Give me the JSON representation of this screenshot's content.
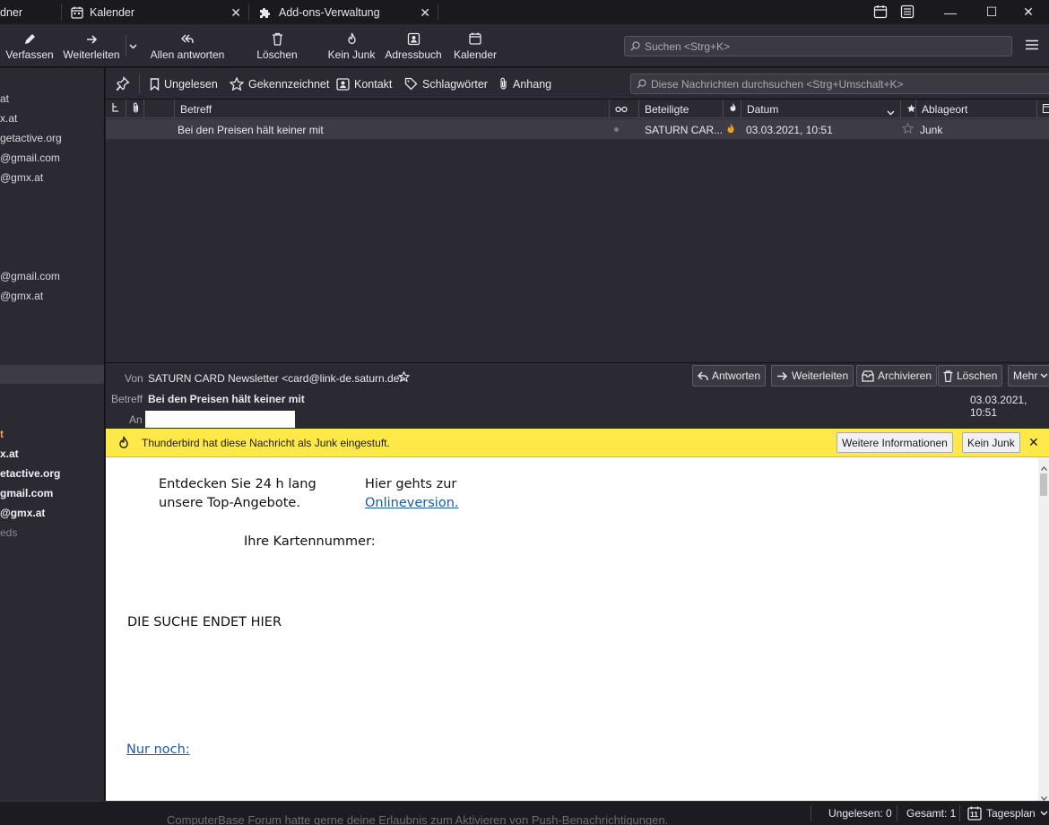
{
  "tabs": [
    {
      "label": "dner"
    },
    {
      "label": "Kalender",
      "close": "✕"
    },
    {
      "label": "Add-ons-Verwaltung",
      "close": "✕"
    }
  ],
  "window_controls": {
    "minimize": "—",
    "maximize": "☐",
    "close": "✕"
  },
  "toolbar": {
    "compose": "Verfassen",
    "forward": "Weiterleiten",
    "reply_all": "Allen antworten",
    "delete": "Löschen",
    "not_junk": "Kein Junk",
    "address_book": "Adressbuch",
    "calendar": "Kalender",
    "search_placeholder": "Suchen <Strg+K>"
  },
  "folder_pane": {
    "items_top": [
      "at",
      "x.at",
      "getactive.org",
      "@gmail.com",
      "@gmx.at"
    ],
    "items_mid": [
      "@gmail.com",
      "@gmx.at"
    ],
    "items_bottom": [
      "t",
      "x.at",
      "etactive.org",
      "gmail.com",
      "@gmx.at",
      "eds"
    ]
  },
  "quick_filter": {
    "unread": "Ungelesen",
    "starred": "Gekennzeichnet",
    "contact": "Kontakt",
    "tags": "Schlagwörter",
    "attachment": "Anhang",
    "search_placeholder": "Diese Nachrichten durchsuchen <Strg+Umschalt+K>"
  },
  "thread_columns": {
    "subject": "Betreff",
    "correspondents": "Beteiligte",
    "date": "Datum",
    "location": "Ablageort"
  },
  "messages": [
    {
      "subject": "Bei den Preisen hält keiner mit",
      "correspondent": "SATURN CAR...",
      "date": "03.03.2021, 10:51",
      "location": "Junk"
    }
  ],
  "header": {
    "from_label": "Von",
    "from": "SATURN CARD Newsletter <card@link-de.saturn.de>",
    "subject_label": "Betreff",
    "subject": "Bei den Preisen hält keiner mit",
    "to_label": "An",
    "date": "03.03.2021, 10:51",
    "buttons": {
      "reply": "Antworten",
      "forward": "Weiterleiten",
      "archive": "Archivieren",
      "delete": "Löschen",
      "more": "Mehr"
    }
  },
  "junk_bar": {
    "message": "Thunderbird hat diese Nachricht als Junk eingestuft.",
    "more_info": "Weitere Informationen",
    "not_junk": "Kein Junk",
    "close": "✕"
  },
  "body": {
    "line1a": "Entdecken Sie 24 h lang",
    "line1b": "unsere Top-Angebote.",
    "line2a": "Hier gehts zur",
    "online_link": "Onlineversion.",
    "card_number": "Ihre Kartennummer:",
    "headline": "DIE SUCHE ENDET HIER",
    "only_link": "Nur noch:"
  },
  "status_bar": {
    "ghost": "ComputerBase Forum hatte gerne deine Erlaubnis zum Aktivieren von Push-Benachrichtigungen.",
    "unread": "Ungelesen: 0",
    "total": "Gesamt: 1",
    "day_plan": "Tagesplan",
    "calendar_day": "11"
  },
  "colors": {
    "accent": "#1d59a8",
    "junk_bar": "#ffe949",
    "junk_flame": "#e8a317",
    "chrome_bg": "#2b2a33"
  }
}
